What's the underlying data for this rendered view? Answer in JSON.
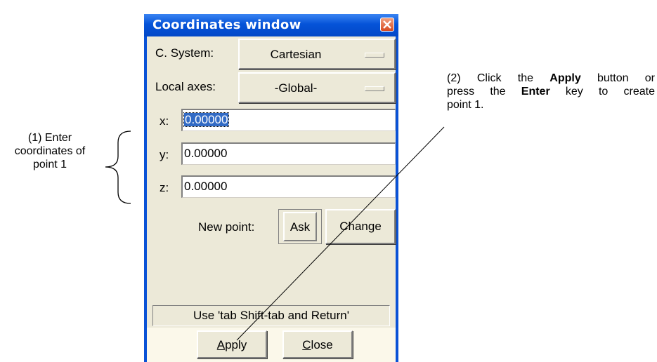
{
  "window": {
    "title": "Coordinates window",
    "c_system_label": "C. System:",
    "c_system_value": "Cartesian",
    "local_axes_label": "Local axes:",
    "local_axes_value": "-Global-",
    "x_label": "x:",
    "x_value": "0.00000",
    "y_label": "y:",
    "y_value": "0.00000",
    "z_label": "z:",
    "z_value": "0.00000",
    "new_point_label": "New point:",
    "ask_button": "Ask",
    "change_button": "Change",
    "status_text": "Use 'tab Shift-tab and Return'",
    "apply_button": {
      "underlined": "A",
      "rest": "pply"
    },
    "close_button": {
      "underlined": "C",
      "rest": "lose"
    }
  },
  "annotations": {
    "left_note": [
      "(1) Enter",
      "coordinates of",
      "point 1"
    ],
    "right_note": {
      "line1_a": "(2) Click the ",
      "line1_bold": "Apply",
      "line1_b": " button or",
      "line2_a": "press the ",
      "line2_bold": "Enter",
      "line2_b": " key to create",
      "line3": "point 1."
    }
  },
  "colors": {
    "titlebar": "#0553d8",
    "dialog_bg": "#ece9d8",
    "selection": "#316ac5",
    "close_button": "#d84a20"
  }
}
